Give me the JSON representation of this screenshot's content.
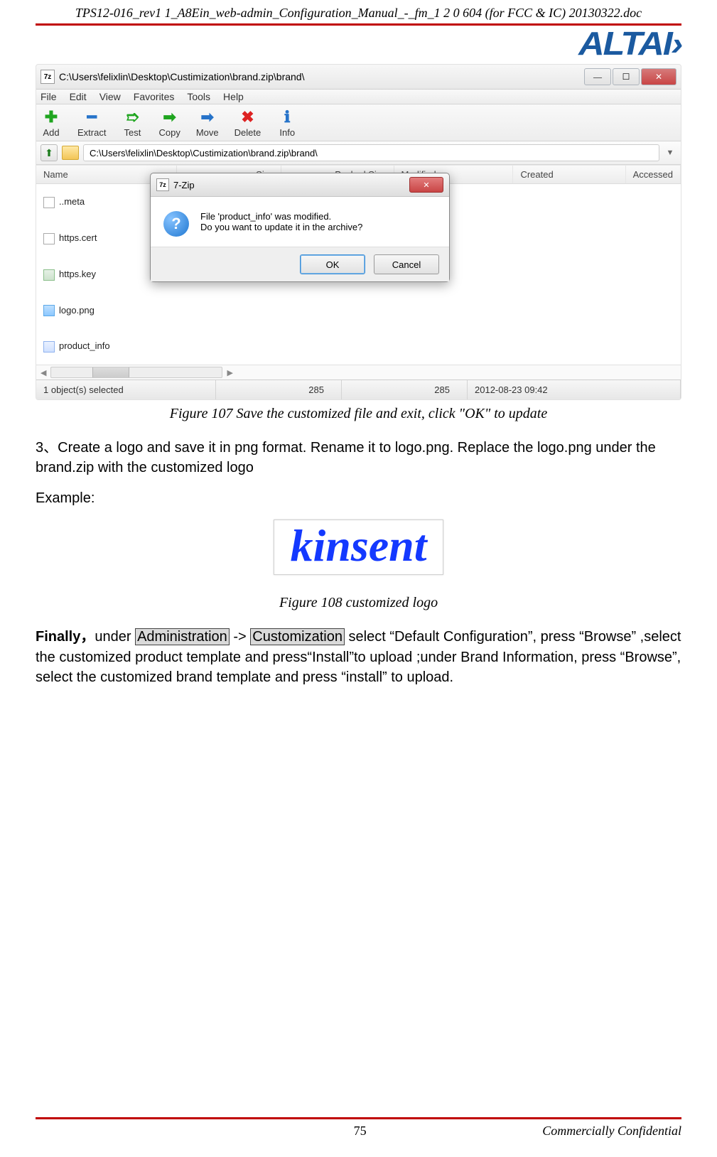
{
  "header": {
    "doc_title": "TPS12-016_rev1 1_A8Ein_web-admin_Configuration_Manual_-_fm_1 2 0 604 (for FCC & IC) 20130322.doc",
    "brand_logo_text": "ALTAI›"
  },
  "screenshot1": {
    "window_path": "C:\\Users\\felixlin\\Desktop\\Custimization\\brand.zip\\brand\\",
    "app_icon_label": "7z",
    "menus": {
      "file": "File",
      "edit": "Edit",
      "view": "View",
      "favorites": "Favorites",
      "tools": "Tools",
      "help": "Help"
    },
    "toolbar": {
      "add": "Add",
      "extract": "Extract",
      "test": "Test",
      "copy": "Copy",
      "move": "Move",
      "delete": "Delete",
      "info": "Info"
    },
    "address": "C:\\Users\\felixlin\\Desktop\\Custimization\\brand.zip\\brand\\",
    "columns": {
      "name": "Name",
      "size": "Size",
      "packed": "Packed Size",
      "modified": "Modified",
      "created": "Created",
      "accessed": "Accessed"
    },
    "rows": [
      {
        "name": "..meta"
      },
      {
        "name": "https.cert"
      },
      {
        "name": "https.key"
      },
      {
        "name": "logo.png"
      },
      {
        "name": "product_info"
      }
    ],
    "dialog": {
      "title": "7-Zip",
      "line1": "File 'product_info' was modified.",
      "line2": "Do you want to update it in the archive?",
      "ok": "OK",
      "cancel": "Cancel"
    },
    "status": {
      "sel": "1 object(s) selected",
      "s1": "285",
      "s2": "285",
      "date": "2012-08-23 09:42"
    }
  },
  "captions": {
    "fig107": "Figure 107 Save the customized file and exit, click \"OK\" to update",
    "fig108": "Figure 108 customized logo"
  },
  "body": {
    "p1": "3、Create a logo and save it in png format. Rename it to logo.png. Replace the logo.png under the brand.zip with the customized logo",
    "p2": "Example:",
    "kinsent": "kinsent",
    "final_prefix": "Finally，",
    "final_under": "under ",
    "admin": "Administration",
    "arrow": " -> ",
    "custom": "Customization",
    "final_rest": " select “Default Configuration”, press “Browse” ,select the customized product template and press“Install”to upload ;under Brand Information, press “Browse”, select the customized brand template and press “install” to upload."
  },
  "footer": {
    "page_num": "75",
    "confidential": "Commercially Confidential"
  }
}
